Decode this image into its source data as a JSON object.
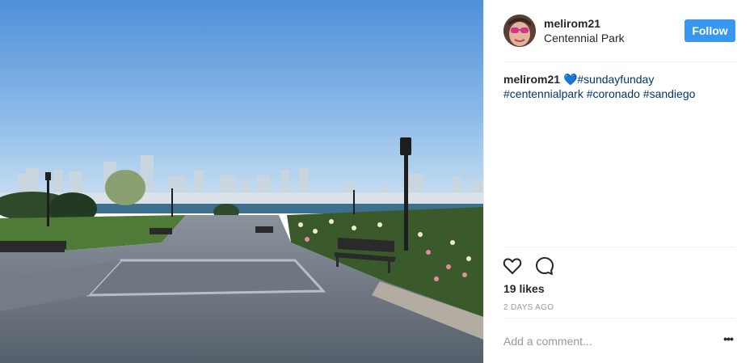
{
  "post": {
    "image_alt": "San Diego skyline from Centennial Park",
    "author": {
      "username": "melirom21",
      "location": "Centennial Park"
    },
    "follow_label": "Follow",
    "caption": {
      "username": "melirom21",
      "heart": "💙",
      "hashtags_line1": "#sundayfunday",
      "hashtags_line2": "#centennialpark #coronado #sandiego"
    },
    "likes": "19 likes",
    "timestamp": "2 DAYS AGO",
    "comment_placeholder": "Add a comment...",
    "more_label": "•••",
    "icons": {
      "like": "heart-outline-icon",
      "comment": "speech-bubble-icon",
      "more": "ellipsis-icon"
    }
  },
  "colors": {
    "accent": "#3897f0",
    "hashtag": "#003569",
    "muted": "#999999",
    "text": "#262626"
  }
}
